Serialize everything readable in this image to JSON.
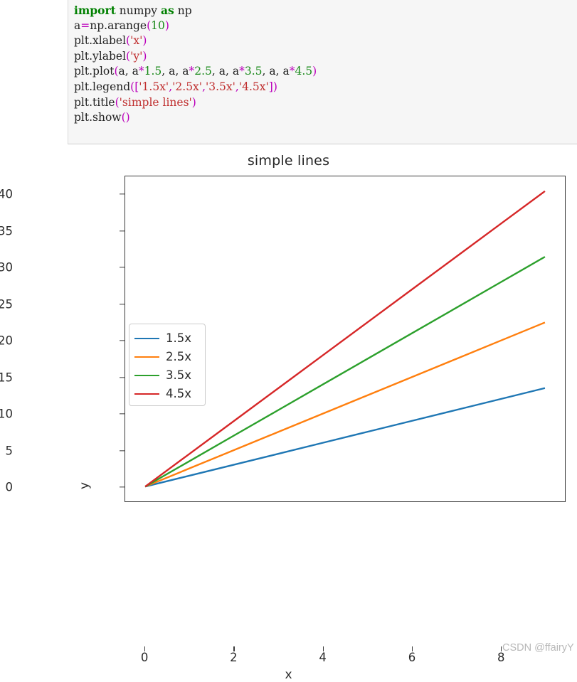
{
  "code_block": {
    "language": "python",
    "lines": [
      [
        {
          "t": "import",
          "c": "kw"
        },
        {
          "t": " numpy ",
          "c": "plain"
        },
        {
          "t": "as",
          "c": "kw"
        },
        {
          "t": " np",
          "c": "plain"
        }
      ],
      [
        {
          "t": "a",
          "c": "plain"
        },
        {
          "t": "=",
          "c": "op"
        },
        {
          "t": "np.arange",
          "c": "plain"
        },
        {
          "t": "(",
          "c": "punct"
        },
        {
          "t": "10",
          "c": "num"
        },
        {
          "t": ")",
          "c": "punct"
        }
      ],
      [
        {
          "t": "plt.xlabel",
          "c": "plain"
        },
        {
          "t": "(",
          "c": "punct"
        },
        {
          "t": "'x'",
          "c": "str"
        },
        {
          "t": ")",
          "c": "punct"
        }
      ],
      [
        {
          "t": "plt.ylabel",
          "c": "plain"
        },
        {
          "t": "(",
          "c": "punct"
        },
        {
          "t": "'y'",
          "c": "str"
        },
        {
          "t": ")",
          "c": "punct"
        }
      ],
      [
        {
          "t": "plt.plot",
          "c": "plain"
        },
        {
          "t": "(",
          "c": "punct"
        },
        {
          "t": "a, a",
          "c": "plain"
        },
        {
          "t": "*",
          "c": "op"
        },
        {
          "t": "1.5",
          "c": "num"
        },
        {
          "t": ", a, a",
          "c": "plain"
        },
        {
          "t": "*",
          "c": "op"
        },
        {
          "t": "2.5",
          "c": "num"
        },
        {
          "t": ", a, a",
          "c": "plain"
        },
        {
          "t": "*",
          "c": "op"
        },
        {
          "t": "3.5",
          "c": "num"
        },
        {
          "t": ", a, a",
          "c": "plain"
        },
        {
          "t": "*",
          "c": "op"
        },
        {
          "t": "4.5",
          "c": "num"
        },
        {
          "t": ")",
          "c": "punct"
        }
      ],
      [
        {
          "t": "plt.legend",
          "c": "plain"
        },
        {
          "t": "([",
          "c": "punct"
        },
        {
          "t": "'1.5x'",
          "c": "str"
        },
        {
          "t": ",",
          "c": "punct"
        },
        {
          "t": "'2.5x'",
          "c": "str"
        },
        {
          "t": ",",
          "c": "punct"
        },
        {
          "t": "'3.5x'",
          "c": "str"
        },
        {
          "t": ",",
          "c": "punct"
        },
        {
          "t": "'4.5x'",
          "c": "str"
        },
        {
          "t": "])",
          "c": "punct"
        }
      ],
      [
        {
          "t": "plt.title",
          "c": "plain"
        },
        {
          "t": "(",
          "c": "punct"
        },
        {
          "t": "'simple lines'",
          "c": "str"
        },
        {
          "t": ")",
          "c": "punct"
        }
      ],
      [
        {
          "t": "plt.show",
          "c": "plain"
        },
        {
          "t": "()",
          "c": "punct"
        }
      ]
    ]
  },
  "watermark": "CSDN @ffairyY",
  "chart_data": {
    "type": "line",
    "title": "simple lines",
    "xlabel": "x",
    "ylabel": "y",
    "x": [
      0,
      1,
      2,
      3,
      4,
      5,
      6,
      7,
      8,
      9
    ],
    "series": [
      {
        "name": "1.5x",
        "color": "#1f77b4",
        "slope": 1.5,
        "values": [
          0,
          1.5,
          3,
          4.5,
          6,
          7.5,
          9,
          10.5,
          12,
          13.5
        ]
      },
      {
        "name": "2.5x",
        "color": "#ff7f0e",
        "slope": 2.5,
        "values": [
          0,
          2.5,
          5,
          7.5,
          10,
          12.5,
          15,
          17.5,
          20,
          22.5
        ]
      },
      {
        "name": "3.5x",
        "color": "#2ca02c",
        "slope": 3.5,
        "values": [
          0,
          3.5,
          7,
          10.5,
          14,
          17.5,
          21,
          24.5,
          28,
          31.5
        ]
      },
      {
        "name": "4.5x",
        "color": "#d62728",
        "slope": 4.5,
        "values": [
          0,
          4.5,
          9,
          13.5,
          18,
          22.5,
          27,
          31.5,
          36,
          40.5
        ]
      }
    ],
    "xticks": [
      "0",
      "2",
      "4",
      "6",
      "8"
    ],
    "xtick_values": [
      0,
      2,
      4,
      6,
      8
    ],
    "yticks": [
      "0",
      "5",
      "10",
      "15",
      "20",
      "25",
      "30",
      "35",
      "40"
    ],
    "ytick_values": [
      0,
      5,
      10,
      15,
      20,
      25,
      30,
      35,
      40
    ],
    "xlim": [
      -0.45,
      9.45
    ],
    "ylim": [
      -2.03,
      42.53
    ],
    "grid": false,
    "legend_position": "upper left",
    "legend_entries": [
      "1.5x",
      "2.5x",
      "3.5x",
      "4.5x"
    ]
  }
}
